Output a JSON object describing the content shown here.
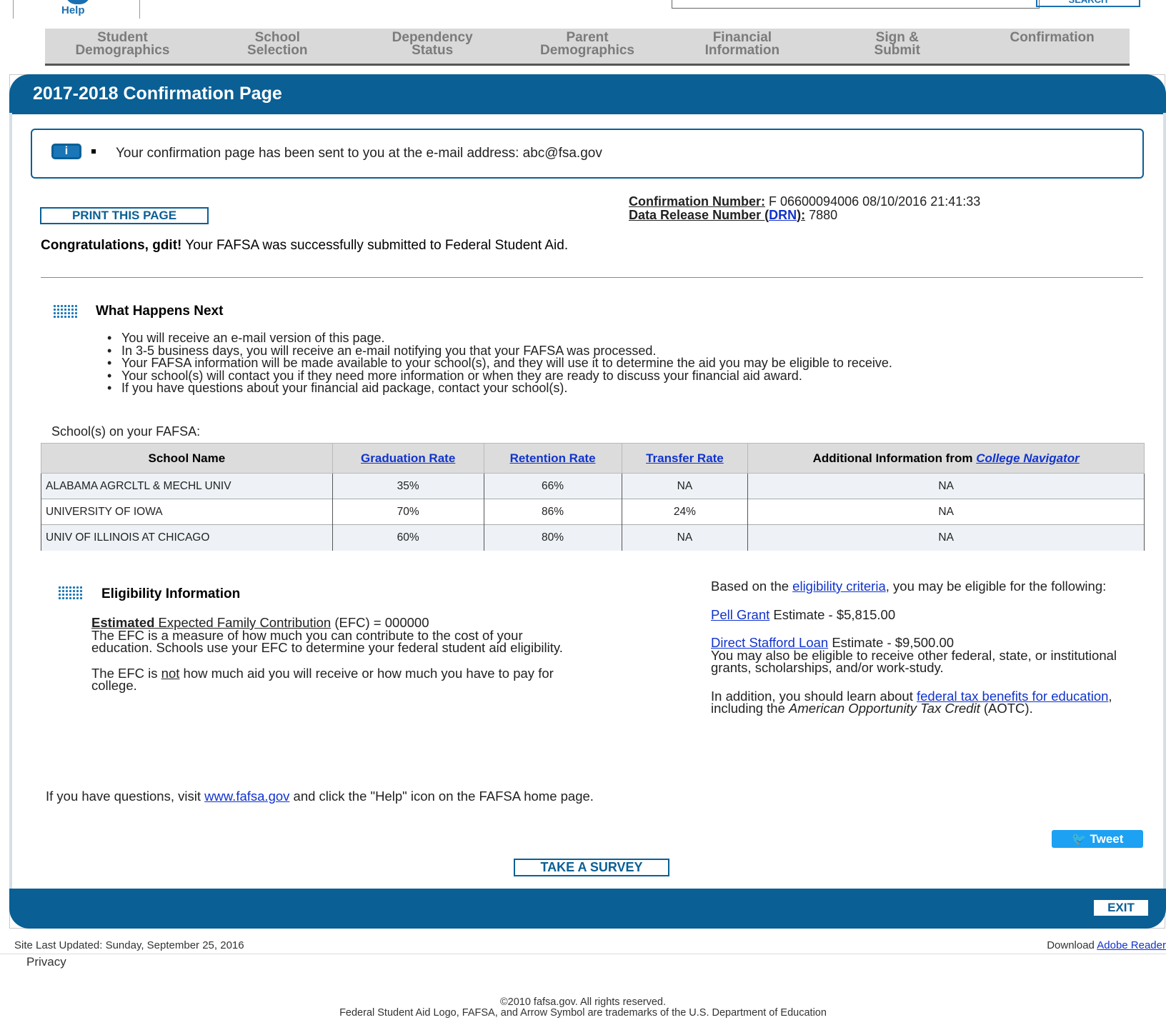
{
  "top": {
    "help_label": "Help",
    "search_label": "SEARCH"
  },
  "steps": [
    {
      "line1": "Student",
      "line2": "Demographics"
    },
    {
      "line1": "School",
      "line2": "Selection"
    },
    {
      "line1": "Dependency",
      "line2": "Status"
    },
    {
      "line1": "Parent",
      "line2": "Demographics"
    },
    {
      "line1": "Financial",
      "line2": "Information"
    },
    {
      "line1": "Sign &",
      "line2": "Submit"
    },
    {
      "line1": "Confirmation",
      "line2": ""
    }
  ],
  "page_title": "2017-2018 Confirmation Page",
  "notice": {
    "icon_glyph": "i",
    "text": "Your confirmation page has been sent to you at the e-mail address: abc@fsa.gov"
  },
  "print_button": "PRINT THIS PAGE",
  "confirmation": {
    "number_label": "Confirmation Number:",
    "number_value": " F 06600094006 08/10/2016 21:41:33",
    "drn_label_pre": "Data Release Number (",
    "drn_link": "DRN",
    "drn_label_post": "):",
    "drn_value": " 7880"
  },
  "congrats": {
    "bold": "Congratulations, gdit!",
    "rest": " Your FAFSA was successfully submitted to Federal Student Aid."
  },
  "what_next": {
    "title": "What Happens Next",
    "items": [
      "You will receive an e-mail version of this page.",
      "In 3-5 business days, you will receive an e-mail notifying you that your FAFSA was processed.",
      "Your FAFSA information will be made available to your school(s), and they will use it to determine the aid you may be eligible to receive.",
      "Your school(s) will contact you if they need more information or when they are ready to discuss your financial aid award.",
      "If you have questions about your financial aid package, contact your school(s)."
    ]
  },
  "schools": {
    "caption": "School(s) on your FAFSA:",
    "headers": {
      "name": "School Name",
      "grad": "Graduation Rate",
      "retention": "Retention Rate",
      "transfer": "Transfer Rate",
      "additional_pre": "Additional Information from ",
      "additional_link": "College Navigator"
    },
    "rows": [
      {
        "name": "ALABAMA AGRCLTL & MECHL UNIV",
        "grad": "35%",
        "retention": "66%",
        "transfer": "NA",
        "additional": "NA"
      },
      {
        "name": "UNIVERSITY OF IOWA",
        "grad": "70%",
        "retention": "86%",
        "transfer": "24%",
        "additional": "NA"
      },
      {
        "name": "UNIV OF ILLINOIS AT CHICAGO",
        "grad": "60%",
        "retention": "80%",
        "transfer": "NA",
        "additional": "NA"
      }
    ]
  },
  "eligibility": {
    "title": "Eligibility Information",
    "efc_bold": "Estimated",
    "efc_link": " Expected Family Contribution",
    "efc_rest": " (EFC) = 000000",
    "efc_desc": "The EFC is a measure of how much you can contribute to the cost of your education. Schools use your EFC to determine your federal student aid eligibility.",
    "efc_not_pre": "The EFC is ",
    "efc_not": "not",
    "efc_not_post": " how much aid you will receive or how much you have to pay for college.",
    "based_pre": "Based on the ",
    "based_link": "eligibility criteria",
    "based_post": ", you may be eligible for the following:",
    "pell_link": "Pell Grant",
    "pell_rest": " Estimate - $5,815.00",
    "stafford_link": "Direct Stafford Loan",
    "stafford_rest": " Estimate - $9,500.00",
    "other": "You may also be eligible to receive other federal, state, or institutional grants, scholarships, and/or work-study.",
    "addition_pre": "In addition, you should learn about ",
    "addition_link": "federal tax benefits for education",
    "addition_mid": ", including the ",
    "addition_italic": "American Opportunity Tax Credit",
    "addition_post": " (AOTC)."
  },
  "help_line": {
    "pre": "If you have questions, visit ",
    "link": "www.fafsa.gov",
    "post": " and click the \"Help\" icon on the FAFSA home page."
  },
  "tweet_button": "Tweet",
  "survey_button": "TAKE A SURVEY",
  "exit_button": "EXIT",
  "footer": {
    "updated": "Site Last Updated: Sunday, September 25, 2016",
    "download_pre": "Download ",
    "download_link": "Adobe Reader",
    "privacy": "Privacy",
    "copyright": "©2010 fafsa.gov. All rights reserved.",
    "trademark": "Federal Student Aid Logo, FAFSA, and Arrow Symbol are trademarks of the U.S. Department of Education"
  }
}
